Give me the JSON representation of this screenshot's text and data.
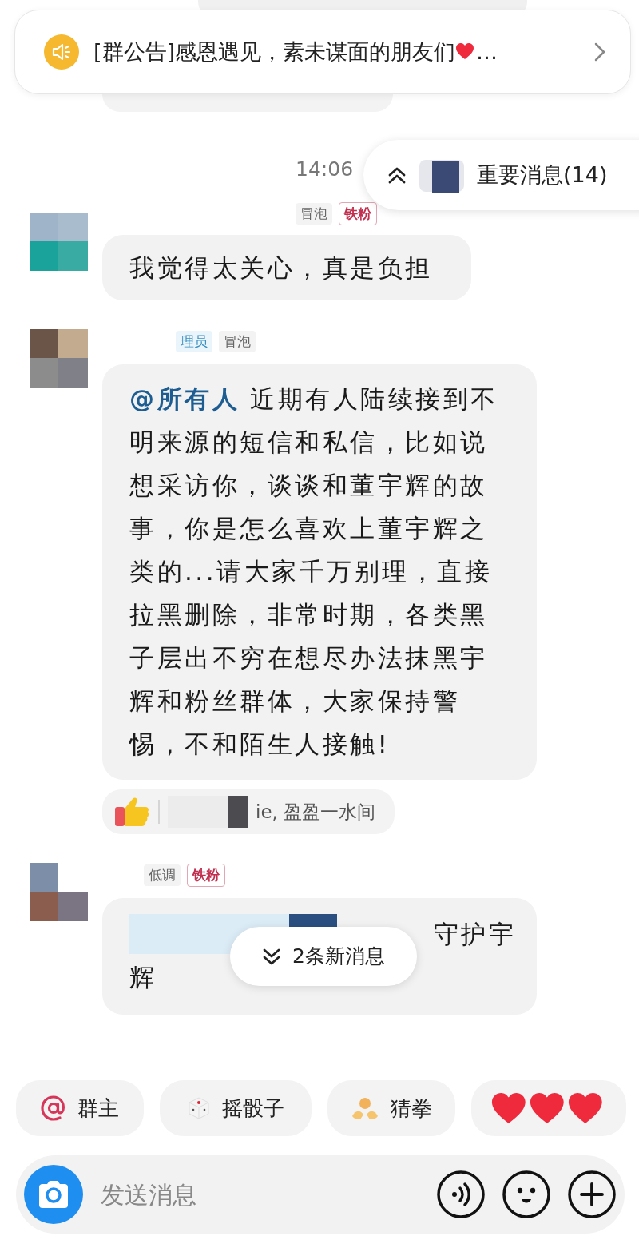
{
  "announcement": {
    "text": "[群公告]感恩遇见，素未谋面的朋友们",
    "suffix": "…"
  },
  "important": {
    "label": "重要消息(14)"
  },
  "time": "14:06",
  "messages": [
    {
      "tags": [
        {
          "label": "冒泡",
          "kind": "level"
        },
        {
          "label": "铁粉",
          "kind": "fan"
        }
      ],
      "text": "我觉得太关心，真是负担"
    },
    {
      "tags": [
        {
          "label": "理员",
          "kind": "admin"
        },
        {
          "label": "冒泡",
          "kind": "level"
        }
      ],
      "mention": "@所有人",
      "text": " 近期有人陆续接到不明来源的短信和私信，比如说想采访你，谈谈和董宇辉的故事，你是怎么喜欢上董宇辉之类的...请大家千万别理，直接拉黑删除，非常时期，各类黑子层出不穷在想尽办法抹黑宇辉和粉丝群体，大家保持警惕，不和陌生人接触!",
      "reaction": {
        "text": "ie, 盈盈一水间"
      }
    },
    {
      "tags": [
        {
          "label": "低调",
          "kind": "level"
        },
        {
          "label": "铁粉",
          "kind": "fan"
        }
      ],
      "lines": [
        "守护宇",
        "辉"
      ],
      "obscured": true
    }
  ],
  "new_messages": {
    "label": "2条新消息"
  },
  "quick_actions": [
    {
      "kind": "mention",
      "label": "群主"
    },
    {
      "kind": "dice",
      "label": "摇骰子"
    },
    {
      "kind": "rps",
      "label": "猜拳"
    },
    {
      "kind": "hearts"
    }
  ],
  "input": {
    "placeholder": "发送消息"
  }
}
